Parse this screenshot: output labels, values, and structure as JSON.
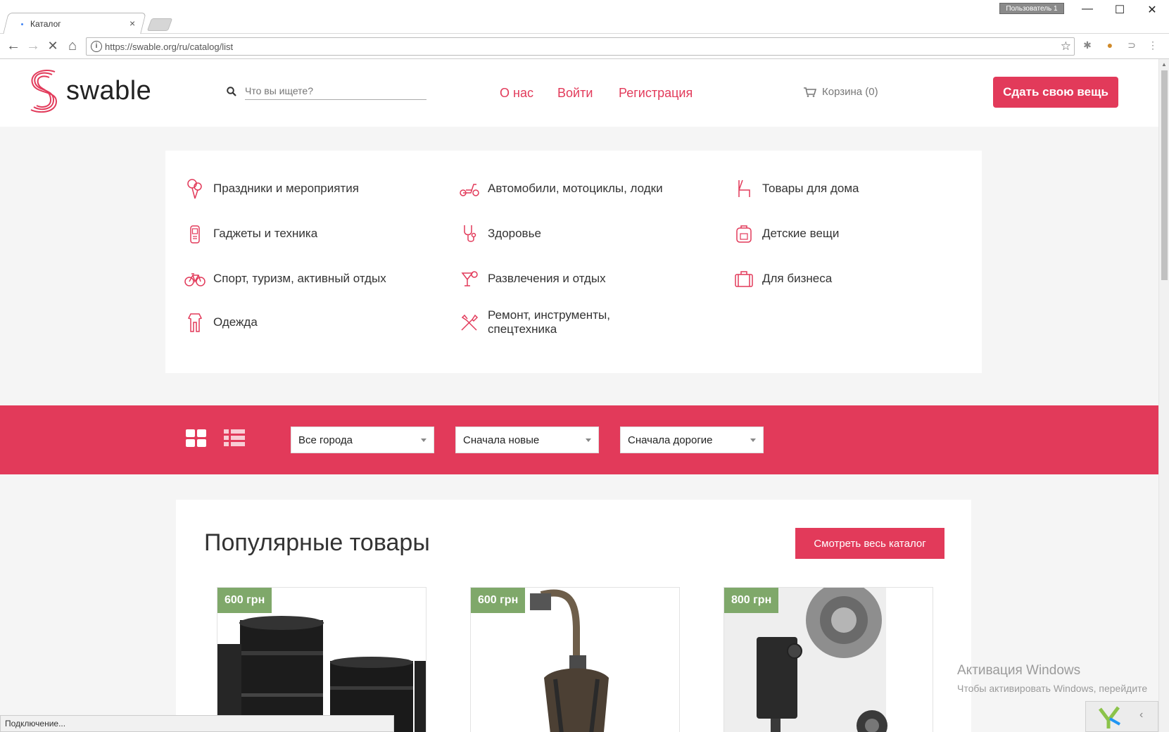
{
  "browser": {
    "tab_title": "Каталог",
    "tab_close": "×",
    "user_badge": "Пользователь 1",
    "url": "https://swable.org/ru/catalog/list",
    "info_glyph": "i",
    "star_glyph": "☆",
    "status": "Подключение...",
    "window_controls": [
      "—",
      "☐",
      "✕"
    ]
  },
  "header": {
    "logo_text": "swable",
    "search_placeholder": "Что вы ищете?",
    "nav": [
      "О нас",
      "Войти",
      "Регистрация"
    ],
    "cart": "Корзина (0)",
    "cta": "Сдать свою вещь",
    "brand_color": "#e23a5a"
  },
  "categories": [
    {
      "label": "Праздники и мероприятия",
      "icon": "balloons-icon"
    },
    {
      "label": "Автомобили, мотоциклы, лодки",
      "icon": "scooter-icon"
    },
    {
      "label": "Товары для дома",
      "icon": "chair-icon"
    },
    {
      "label": "Гаджеты и техника",
      "icon": "phone-icon"
    },
    {
      "label": "Здоровье",
      "icon": "stethoscope-icon"
    },
    {
      "label": "Детские вещи",
      "icon": "backpack-icon"
    },
    {
      "label": "Спорт, туризм, активный отдых",
      "icon": "bicycle-icon"
    },
    {
      "label": "Развлечения и отдых",
      "icon": "cocktail-icon"
    },
    {
      "label": "Для бизнеса",
      "icon": "briefcase-icon"
    },
    {
      "label": "Одежда",
      "icon": "clothes-icon"
    },
    {
      "label": "Ремонт, инструменты, спецтехника",
      "icon": "tools-icon"
    }
  ],
  "filters": {
    "city": "Все города",
    "sort_date": "Сначала новые",
    "sort_price": "Сначала дорогие"
  },
  "popular": {
    "title": "Популярные товары",
    "button": "Смотреть весь каталог",
    "items": [
      {
        "price": "600 грн"
      },
      {
        "price": "600 грн"
      },
      {
        "price": "800 грн"
      }
    ],
    "price_color": "#7fa86a"
  },
  "watermark": {
    "line1": "Активация Windows",
    "line2": "Чтобы активировать Windows, перейдите"
  }
}
